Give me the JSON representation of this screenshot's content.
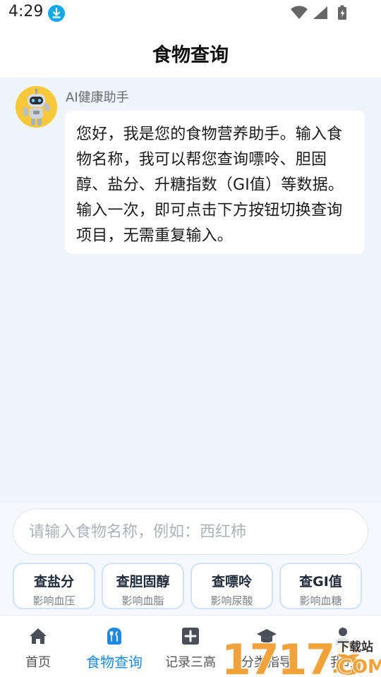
{
  "status": {
    "time": "4:29"
  },
  "header": {
    "title": "食物查询"
  },
  "chat": {
    "bot_name": "AI健康助手",
    "message": "您好，我是您的食物营养助手。输入食物名称，我可以帮您查询嘌呤、胆固醇、盐分、升糖指数（GI值）等数据。输入一次，即可点击下方按钮切换查询项目，无需重复输入。"
  },
  "search": {
    "placeholder": "请输入食物名称，例如：西红柿",
    "value": ""
  },
  "query_buttons": [
    {
      "label": "查盐分",
      "sub": "影响血压"
    },
    {
      "label": "查胆固醇",
      "sub": "影响血脂"
    },
    {
      "label": "查嘌呤",
      "sub": "影响尿酸"
    },
    {
      "label": "查GI值",
      "sub": "影响血糖"
    }
  ],
  "tabs": [
    {
      "label": "首页",
      "icon": "home-icon"
    },
    {
      "label": "食物查询",
      "icon": "utensils-icon",
      "active": true
    },
    {
      "label": "记录三高",
      "icon": "plus-square-icon"
    },
    {
      "label": "分类指导",
      "icon": "graduation-cap-icon"
    },
    {
      "label": "我的",
      "icon": "user-icon"
    }
  ],
  "watermark": {
    "brand": "17178",
    "com": ".COM",
    "tag": "下载站"
  },
  "colors": {
    "accent": "#1e88e5",
    "chat_bg": "#eef5fd",
    "avatar_bg": "#f7c93a",
    "download_badge": "#16a9e9"
  }
}
